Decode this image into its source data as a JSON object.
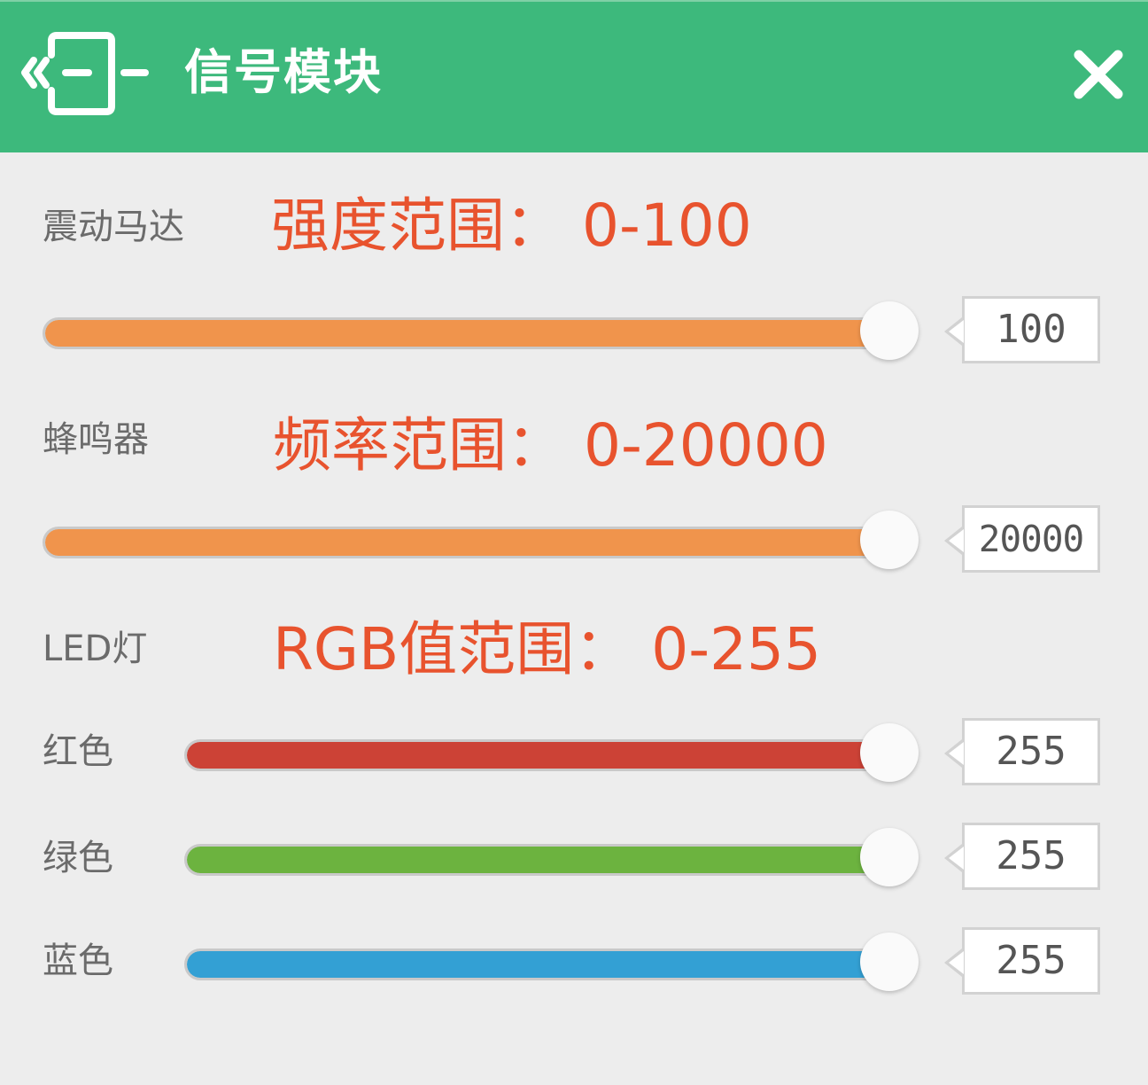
{
  "header": {
    "title": "信号模块",
    "background": "#3db97c",
    "back_icon": "exit-door-icon",
    "close_icon": "close-icon"
  },
  "vibration": {
    "label": "震动马达",
    "hint": "强度范围： 0-100",
    "value": "100",
    "min": 0,
    "max": 100,
    "fill_color": "#f0944c"
  },
  "buzzer": {
    "label": "蜂鸣器",
    "hint": "频率范围： 0-20000",
    "value": "20000",
    "min": 0,
    "max": 20000,
    "fill_color": "#f0944c"
  },
  "led": {
    "label": "LED灯",
    "hint": "RGB值范围： 0-255",
    "channels": [
      {
        "label": "红色",
        "value": "255",
        "min": 0,
        "max": 255,
        "fill_color": "#cc4236"
      },
      {
        "label": "绿色",
        "value": "255",
        "min": 0,
        "max": 255,
        "fill_color": "#6cb33f"
      },
      {
        "label": "蓝色",
        "value": "255",
        "min": 0,
        "max": 255,
        "fill_color": "#33a0d4"
      }
    ]
  }
}
